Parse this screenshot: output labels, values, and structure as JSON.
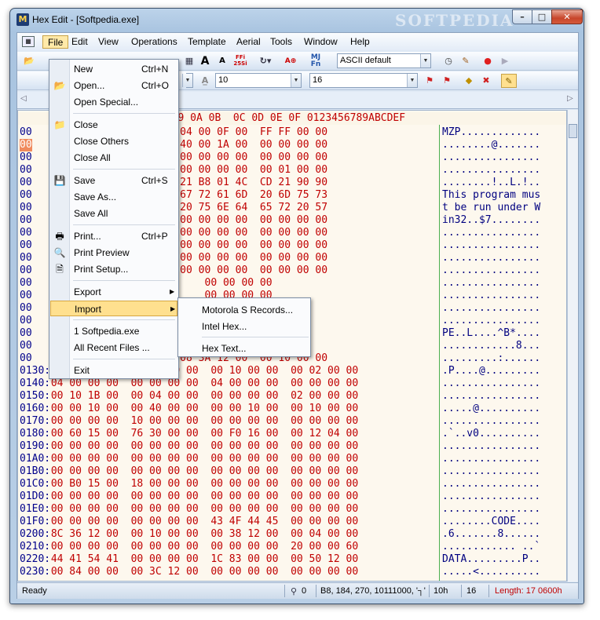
{
  "window": {
    "title": "Hex Edit - [Softpedia.exe]",
    "watermark": "SOFTPEDIA",
    "app_icon": "M",
    "min": "–",
    "max": "□",
    "close": "✕"
  },
  "menubar": [
    "File",
    "Edit",
    "View",
    "Operations",
    "Template",
    "Aerial",
    "Tools",
    "Window",
    "Help"
  ],
  "toolbar": {
    "charset_combo": "ASCII default",
    "font_combo_1": "10",
    "font_combo_2": "16",
    "icons": [
      "open-icon",
      "font-larger-icon",
      "font-smaller-icon",
      "ffi-icon",
      "aerial-icon",
      "ascii-ebcdic-icon",
      "mj-fn-icon",
      "clock-icon",
      "pen-icon",
      "record-icon",
      "play-icon",
      "flag-icon",
      "flags-icon",
      "bookmark-add-icon",
      "bookmark-remove-icon",
      "calculator-icon"
    ],
    "ffi_label": "FFi\n25Si",
    "font_larger": "A",
    "font_smaller": "A",
    "mj": "MJ",
    "fn": "Fn"
  },
  "hex": {
    "header": "         04 05 06 07  08 09 0A 0B  0C 0D 0E 0F 0123456789ABCDEF",
    "rows": [
      {
        "off": "00",
        "hex": "         02 00 00 00  04 00 0F 00  FF FF 00 00",
        "asc": "MZP............."
      },
      {
        "off": "00",
        "hex": "         00 00 00 00  40 00 1A 00  00 00 00 00",
        "asc": "........@......."
      },
      {
        "off": "00",
        "hex": "         00 00 00 00  00 00 00 00  00 00 00 00",
        "asc": "................"
      },
      {
        "off": "00",
        "hex": "         00 00 00 00  00 00 00 00  00 01 00 00",
        "asc": "................"
      },
      {
        "off": "00",
        "hex": "         1F B4 09 CD  21 B8 01 4C  CD 21 90 90",
        "asc": "........!..L.!.."
      },
      {
        "off": "00",
        "hex": "         20 70 72 6F  67 72 61 6D  20 6D 75 73",
        "asc": "This program mus"
      },
      {
        "off": "00",
        "hex": "         20 72 75 6E  20 75 6E 64  65 72 20 57",
        "asc": "t be run under W"
      },
      {
        "off": "00",
        "hex": "         0D 0A 24 37  00 00 00 00  00 00 00 00",
        "asc": "in32..$7........"
      },
      {
        "off": "00",
        "hex": "         00 00 00 00  00 00 00 00  00 00 00 00",
        "asc": "................"
      },
      {
        "off": "00",
        "hex": "         00 00 00 00  00 00 00 00  00 00 00 00",
        "asc": "................"
      },
      {
        "off": "00",
        "hex": "         00 00 00 00  00 00 00 00  00 00 00 00",
        "asc": "................"
      },
      {
        "off": "00",
        "hex": "         00 00 00 00  00 00 00 00  00 00 00 00",
        "asc": "................"
      },
      {
        "off": "00",
        "hex": "                          00 00 00 00",
        "asc": "................"
      },
      {
        "off": "00",
        "hex": "                          00 00 00 00",
        "asc": "................"
      },
      {
        "off": "00",
        "hex": "                          00 00 00 00",
        "asc": "................"
      },
      {
        "off": "00",
        "hex": "                          00 00 00 00",
        "asc": "................"
      },
      {
        "off": "00",
        "hex": "                    42 2A  00 00 00 00",
        "asc": "PE..L....^B*...."
      },
      {
        "off": "00",
        "hex": "                    02 19  00 38 12 00",
        "asc": "............8..."
      },
      {
        "off": "00",
        "hex": "         00 00 00 00  08 3A 12 00  00 10 00 00",
        "asc": ".........:......"
      },
      {
        "off": "0130:",
        "hex": " 00 50 12 00  00 00 40 00  00 10 00 00  00 02 00 00",
        "asc": ".P....@........."
      },
      {
        "off": "0140:",
        "hex": " 04 00 00 00  00 00 00 00  04 00 00 00  00 00 00 00",
        "asc": "................"
      },
      {
        "off": "0150:",
        "hex": " 00 10 1B 00  00 04 00 00  00 00 00 00  02 00 00 00",
        "asc": "................"
      },
      {
        "off": "0160:",
        "hex": " 00 00 10 00  00 40 00 00  00 00 10 00  00 10 00 00",
        "asc": ".....@.........."
      },
      {
        "off": "0170:",
        "hex": " 00 00 00 00  10 00 00 00  00 00 00 00  00 00 00 00",
        "asc": "................"
      },
      {
        "off": "0180:",
        "hex": " 00 60 15 00  76 30 00 00  00 F0 16 00  00 12 04 00",
        "asc": ".`..v0.........."
      },
      {
        "off": "0190:",
        "hex": " 00 00 00 00  00 00 00 00  00 00 00 00  00 00 00 00",
        "asc": "................"
      },
      {
        "off": "01A0:",
        "hex": " 00 00 00 00  00 00 00 00  00 00 00 00  00 00 00 00",
        "asc": "................"
      },
      {
        "off": "01B0:",
        "hex": " 00 00 00 00  00 00 00 00  00 00 00 00  00 00 00 00",
        "asc": "................"
      },
      {
        "off": "01C0:",
        "hex": " 00 B0 15 00  18 00 00 00  00 00 00 00  00 00 00 00",
        "asc": "................"
      },
      {
        "off": "01D0:",
        "hex": " 00 00 00 00  00 00 00 00  00 00 00 00  00 00 00 00",
        "asc": "................"
      },
      {
        "off": "01E0:",
        "hex": " 00 00 00 00  00 00 00 00  00 00 00 00  00 00 00 00",
        "asc": "................"
      },
      {
        "off": "01F0:",
        "hex": " 00 00 00 00  00 00 00 00  43 4F 44 45  00 00 00 00",
        "asc": "........CODE...."
      },
      {
        "off": "0200:",
        "hex": " 8C 36 12 00  00 10 00 00  00 38 12 00  00 04 00 00",
        "asc": ".6.......8......"
      },
      {
        "off": "0210:",
        "hex": " 00 00 00 00  00 00 00 00  00 00 00 00  20 00 00 60",
        "asc": "............ ..`"
      },
      {
        "off": "0220:",
        "hex": " 44 41 54 41  00 00 00 00  1C 83 00 00  00 50 12 00",
        "asc": "DATA.........P.."
      },
      {
        "off": "0230:",
        "hex": " 00 84 00 00  00 3C 12 00  00 00 00 00  00 00 00 00",
        "asc": ".....<.........."
      }
    ]
  },
  "file_menu": {
    "items": [
      {
        "label": "New",
        "key": "Ctrl+N",
        "icon": ""
      },
      {
        "label": "Open...",
        "key": "Ctrl+O",
        "icon": "📂"
      },
      {
        "label": "Open Special...",
        "key": "",
        "icon": ""
      },
      {
        "label": "Close",
        "key": "",
        "icon": "📁"
      },
      {
        "label": "Close Others",
        "key": "",
        "icon": ""
      },
      {
        "label": "Close All",
        "key": "",
        "icon": ""
      },
      {
        "label": "Save",
        "key": "Ctrl+S",
        "icon": "💾"
      },
      {
        "label": "Save As...",
        "key": "",
        "icon": ""
      },
      {
        "label": "Save All",
        "key": "",
        "icon": ""
      },
      {
        "label": "Print...",
        "key": "Ctrl+P",
        "icon": "🖶"
      },
      {
        "label": "Print Preview",
        "key": "",
        "icon": "🔍"
      },
      {
        "label": "Print Setup...",
        "key": "",
        "icon": "🗎"
      },
      {
        "label": "Export",
        "key": "",
        "icon": ""
      },
      {
        "label": "Import",
        "key": "",
        "icon": ""
      },
      {
        "label": "1 Softpedia.exe",
        "key": "",
        "icon": ""
      },
      {
        "label": "All Recent Files ...",
        "key": "",
        "icon": ""
      },
      {
        "label": "Exit",
        "key": "",
        "icon": ""
      }
    ]
  },
  "import_menu": [
    "Motorola S Records...",
    "Intel Hex...",
    "Hex Text..."
  ],
  "status": {
    "ready": "Ready",
    "count": "0",
    "value": "B8, 184, 270, 10111000, '┐'",
    "hex_off": "10h",
    "width": "16",
    "length": "Length: 17 0600h"
  }
}
